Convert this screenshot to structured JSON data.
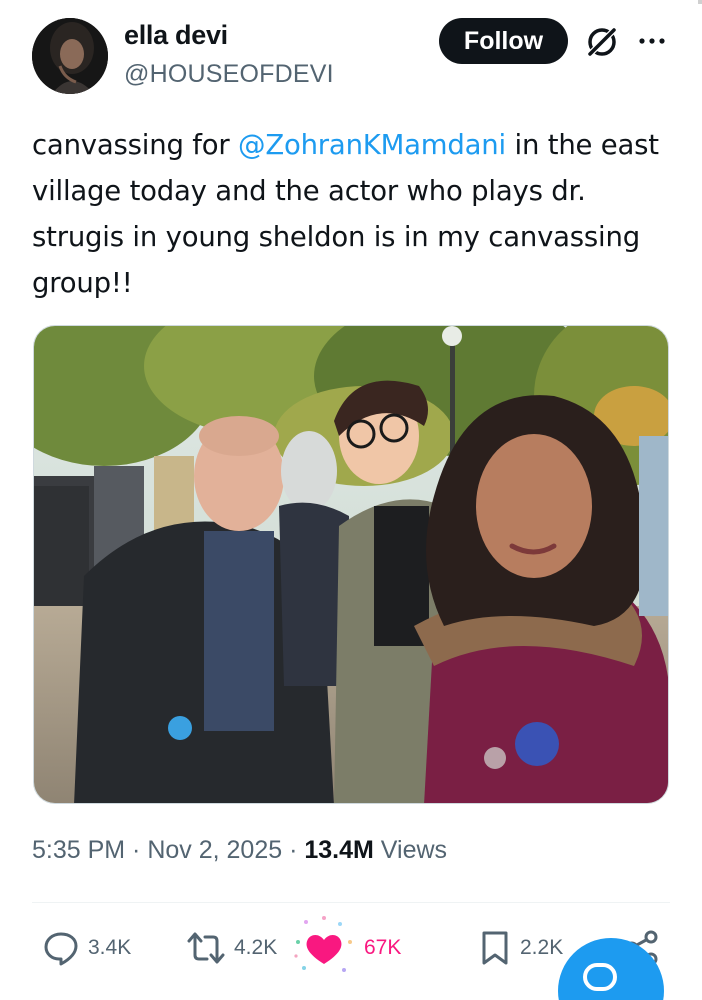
{
  "author": {
    "display_name": "ella devi",
    "handle": "@HOUSEOFDEVI"
  },
  "header": {
    "follow_label": "Follow",
    "grok_icon": "grok-icon",
    "more_icon": "more-options-icon"
  },
  "tweet": {
    "text_before": "canvassing for ",
    "mention": "@ZohranKMamdani",
    "text_after": " in the east village today and the actor who plays dr. strugis in young sheldon is in my canvassing group!!"
  },
  "meta": {
    "time": "5:35 PM",
    "separator": " · ",
    "date": "Nov 2, 2025",
    "views_count": "13.4M",
    "views_label": " Views"
  },
  "actions": {
    "replies": "3.4K",
    "reposts": "4.2K",
    "likes": "67K",
    "bookmarks": "2.2K"
  },
  "colors": {
    "accent": "#1d9bf0",
    "like": "#f91880",
    "text": "#0f1419",
    "secondary": "#536471"
  }
}
